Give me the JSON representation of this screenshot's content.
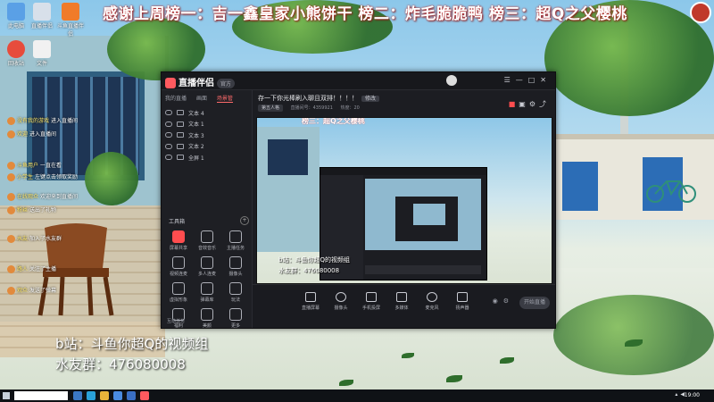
{
  "stream_overlay": {
    "banner": "感谢上周榜一：吉一鑫皇家小熊饼干 榜二：炸毛脆脆鸭 榜三：超Q之父樱桃",
    "line1": "b站：斗鱼你超Q的视频组",
    "line2": "水友群：476080008"
  },
  "app": {
    "name": "直播伴侣",
    "version_badge": "官方",
    "tabs": [
      "我的直播",
      "画面",
      "场景管"
    ],
    "active_tab_index": 2,
    "scenes": [
      "文本 4",
      "文本 1",
      "文本 3",
      "文本 2",
      "全屏 1"
    ],
    "tools_title": "工具箱",
    "tools_plus": "+",
    "tools": [
      "屏幕共享",
      "音效音乐",
      "主播任务",
      "视频连麦",
      "多人连麦",
      "摄像头",
      "虚拟形象",
      "弹幕库",
      "玩法",
      "福利",
      "美颜",
      "更多"
    ],
    "tools_highlight_index": 0,
    "sidebar_status": "互动任务",
    "stream_title": "存一下你光棒刷入聊且双排！！！！",
    "edit_label": "修改",
    "meta": [
      "第五人格",
      "直播间号：4359921",
      "热度：20"
    ],
    "meta_badge": "第五人格",
    "controls": [
      "直播屏幕",
      "摄像头",
      "手机投屏",
      "多媒体",
      "麦克风",
      "扬声器"
    ],
    "go_live_label": "开始直播",
    "preview_cap1": "b站：斗鱼你超Q的视频组",
    "preview_cap2": "水友群：476080008",
    "preview_banner": "榜三：超Q之父樱桃"
  },
  "desktop_icons": [
    "此电脑",
    "直播伴侣",
    "斗鱼直播伴侣",
    "回收站",
    "文件"
  ],
  "chat_lines": [
    {
      "user": "没有我的游戏",
      "text": "进入直播间"
    },
    {
      "user": "欢迎",
      "text": "进入直播间"
    },
    {
      "user": "斗鱼用户",
      "text": "一直在看"
    },
    {
      "user": "小学生",
      "text": "左键点击领取奖励"
    },
    {
      "user": "在线观众",
      "text": "欢迎来到直播间"
    },
    {
      "user": "粉丝",
      "text": "送出了礼物"
    },
    {
      "user": "水友",
      "text": "加入了水友群"
    },
    {
      "user": "路人",
      "text": "关注了主播"
    },
    {
      "user": "观众",
      "text": "发送了弹幕"
    }
  ],
  "clock": "19:00",
  "colors": {
    "accent": "#ff4d4f",
    "app_bg": "#1c1d22",
    "banner_shadow": "#c42a2a"
  }
}
